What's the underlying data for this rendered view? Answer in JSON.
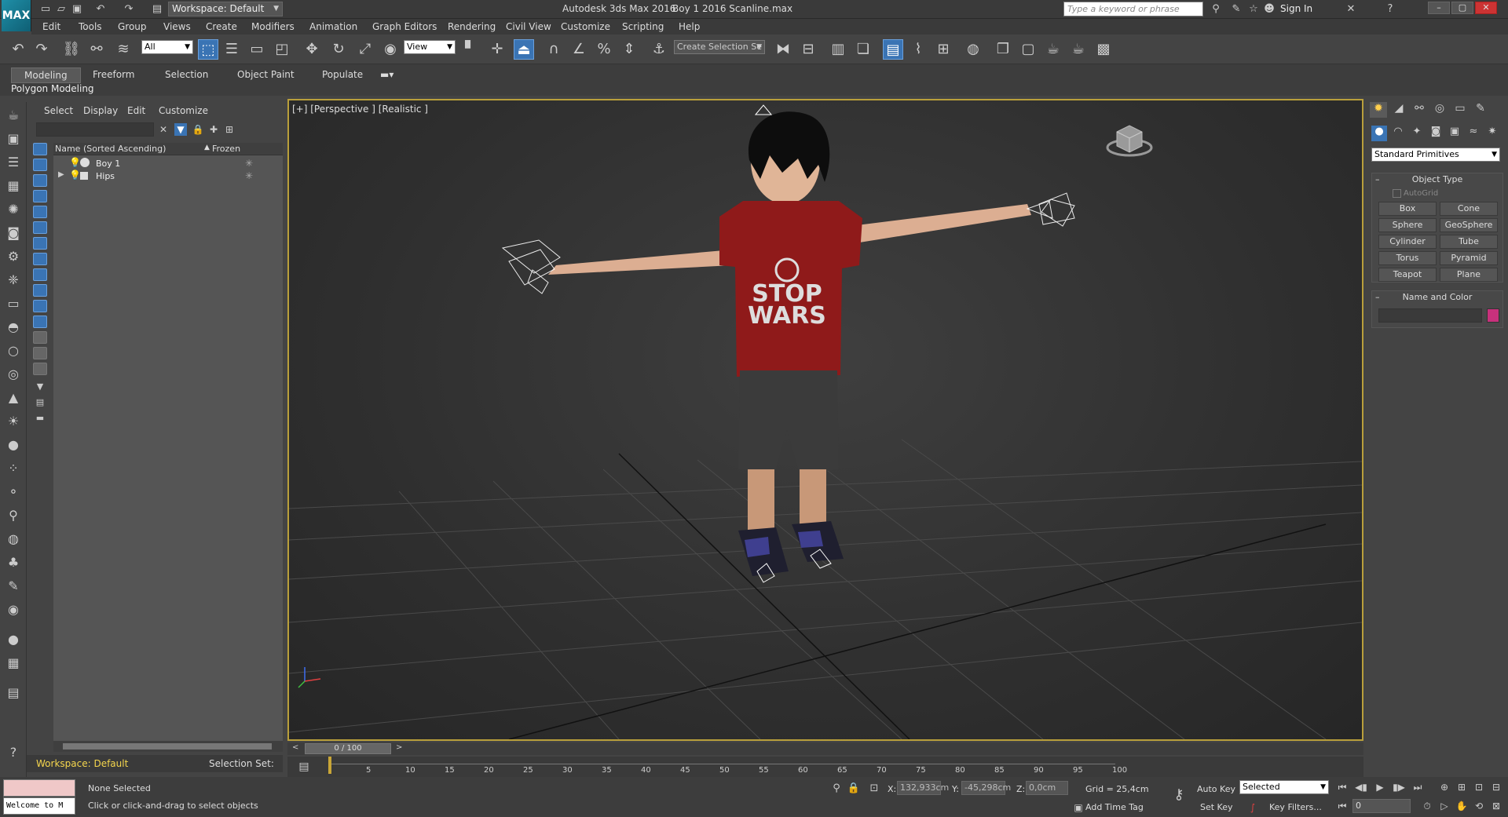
{
  "title_bar": {
    "app_logo": "MAX",
    "workspace": "Workspace: Default",
    "app_title": "Autodesk 3ds Max 2016",
    "file_name": "Boy 1 2016 Scanline.max",
    "search_placeholder": "Type a keyword or phrase",
    "sign_in": "Sign In"
  },
  "menu": [
    "Edit",
    "Tools",
    "Group",
    "Views",
    "Create",
    "Modifiers",
    "Animation",
    "Graph Editors",
    "Rendering",
    "Civil View",
    "Customize",
    "Scripting",
    "Help"
  ],
  "toolbar": {
    "filter": "All",
    "ref_coord": "View",
    "selection_set": "Create Selection Se"
  },
  "ribbon": {
    "tabs": [
      "Modeling",
      "Freeform",
      "Selection",
      "Object Paint",
      "Populate"
    ],
    "active_tab": "Modeling",
    "sub_label": "Polygon Modeling"
  },
  "scene_explorer": {
    "menu": [
      "Select",
      "Display",
      "Edit",
      "Customize"
    ],
    "col_name": "Name (Sorted Ascending)",
    "col_frozen": "Frozen",
    "rows": [
      {
        "name": "Boy 1"
      },
      {
        "name": "Hips"
      }
    ],
    "workspace": "Workspace: Default",
    "selection_set": "Selection Set:"
  },
  "viewport": {
    "label": "[+] [Perspective ] [Realistic ]",
    "shirt_line1": "STOP",
    "shirt_line2": "WARS"
  },
  "timeline": {
    "frame_display": "0 / 100",
    "ticks": [
      "5",
      "10",
      "15",
      "20",
      "25",
      "30",
      "35",
      "40",
      "45",
      "50",
      "55",
      "60",
      "65",
      "70",
      "75",
      "80",
      "85",
      "90",
      "95",
      "100"
    ]
  },
  "status": {
    "maxscript_output": "Welcome to M",
    "selection_status": "None Selected",
    "prompt": "Click or click-and-drag to select objects",
    "x_label": "X:",
    "x_value": "132,933cm",
    "y_label": "Y:",
    "y_value": "-45,298cm",
    "z_label": "Z:",
    "z_value": "0,0cm",
    "grid": "Grid = 25,4cm",
    "add_time_tag": "Add Time Tag",
    "auto_key": "Auto Key",
    "set_key": "Set Key",
    "key_mode": "Selected",
    "key_filters": "Key Filters...",
    "current_frame": "0"
  },
  "command_panel": {
    "category": "Standard Primitives",
    "object_type_title": "Object Type",
    "autogrid": "AutoGrid",
    "primitives": [
      "Box",
      "Cone",
      "Sphere",
      "GeoSphere",
      "Cylinder",
      "Tube",
      "Torus",
      "Pyramid",
      "Teapot",
      "Plane"
    ],
    "name_color_title": "Name and Color",
    "color": "#c8317c"
  }
}
